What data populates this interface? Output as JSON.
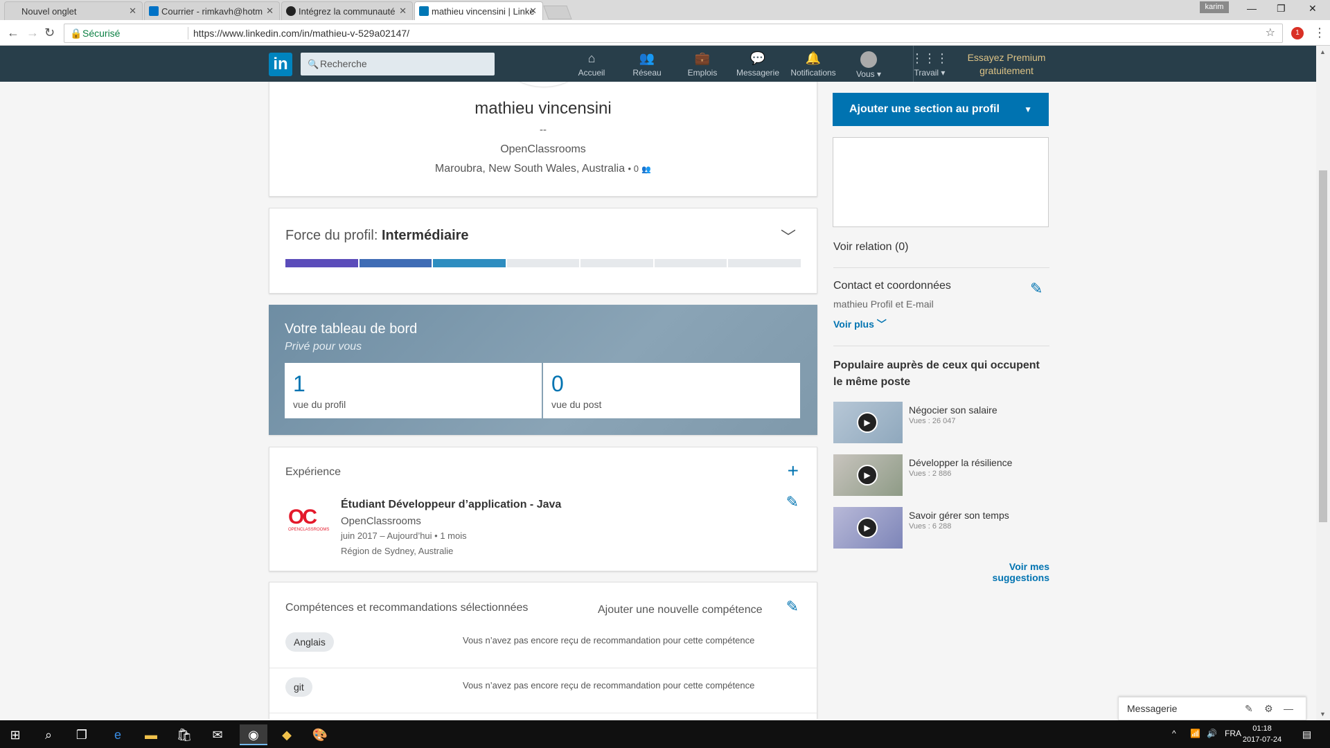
{
  "browser": {
    "tabs": [
      {
        "title": "Nouvel onglet"
      },
      {
        "title": "Courrier - rimkavh@hotm"
      },
      {
        "title": "Intégrez la communauté"
      },
      {
        "title": "mathieu vincensini | Linke"
      }
    ],
    "user_badge": "karim",
    "secure_label": "Sécurisé",
    "url": "https://www.linkedin.com/in/mathieu-v-529a02147/",
    "ext_badge": "1"
  },
  "linkedin_nav": {
    "logo": "in",
    "search_placeholder": "Recherche",
    "items": [
      {
        "label": "Accueil",
        "icon": "home-icon"
      },
      {
        "label": "Réseau",
        "icon": "network-icon"
      },
      {
        "label": "Emplois",
        "icon": "briefcase-icon"
      },
      {
        "label": "Messagerie",
        "icon": "messaging-icon"
      },
      {
        "label": "Notifications",
        "icon": "bell-icon"
      },
      {
        "label": "Vous ▾",
        "icon": "avatar-icon"
      },
      {
        "label": "Travail ▾",
        "icon": "grid-icon"
      }
    ],
    "premium": "Essayez Premium gratuitement"
  },
  "profile": {
    "name": "mathieu vincensini",
    "headline": "--",
    "company": "OpenClassrooms",
    "location": "Maroubra, New South Wales, Australia",
    "connections": "• 0"
  },
  "strength": {
    "label": "Force du profil:",
    "level": "Intermédiaire",
    "filled_segments": 3,
    "total_segments": 7,
    "colors": [
      "#5b4cba",
      "#3f6cb5",
      "#2e8dc0"
    ]
  },
  "dashboard": {
    "title": "Votre tableau de bord",
    "subtitle": "Privé pour vous",
    "stats": [
      {
        "value": "1",
        "label": "vue du profil"
      },
      {
        "value": "0",
        "label": "vue du post"
      }
    ]
  },
  "experience": {
    "title": "Expérience",
    "logo_text": "OC",
    "logo_sub": "OPENCLASSROOMS",
    "job_title": "Étudiant Développeur d’application - Java",
    "company": "OpenClassrooms",
    "dates": "juin 2017 – Aujourd’hui   • 1 mois",
    "region": "Région de Sydney, Australie"
  },
  "skills": {
    "title": "Compétences et recommandations sélectionnées",
    "add_label": "Ajouter une nouvelle compétence",
    "items": [
      {
        "name": "Anglais",
        "rec": "Vous n’avez pas encore reçu de recommandation pour cette compétence"
      },
      {
        "name": "git",
        "rec": "Vous n’avez pas encore reçu de recommandation pour cette compétence"
      }
    ]
  },
  "rail": {
    "add_section": "Ajouter une section au profil",
    "voir_relation": "Voir relation (0)",
    "contact_title": "Contact et coordonnées",
    "contact_sub": "mathieu Profil et E-mail",
    "voir_plus": "Voir plus",
    "popular_title": "Populaire auprès de ceux qui occupent le même poste",
    "courses": [
      {
        "title": "Négocier son salaire",
        "views": "Vues : 26 047"
      },
      {
        "title": "Développer la résilience",
        "views": "Vues : 2 886"
      },
      {
        "title": "Savoir gérer son temps",
        "views": "Vues : 6 288"
      }
    ],
    "suggestions": "Voir mes suggestions"
  },
  "messaging": {
    "label": "Messagerie"
  },
  "taskbar": {
    "lang": "FRA",
    "time": "01:18",
    "date": "2017-07-24"
  }
}
